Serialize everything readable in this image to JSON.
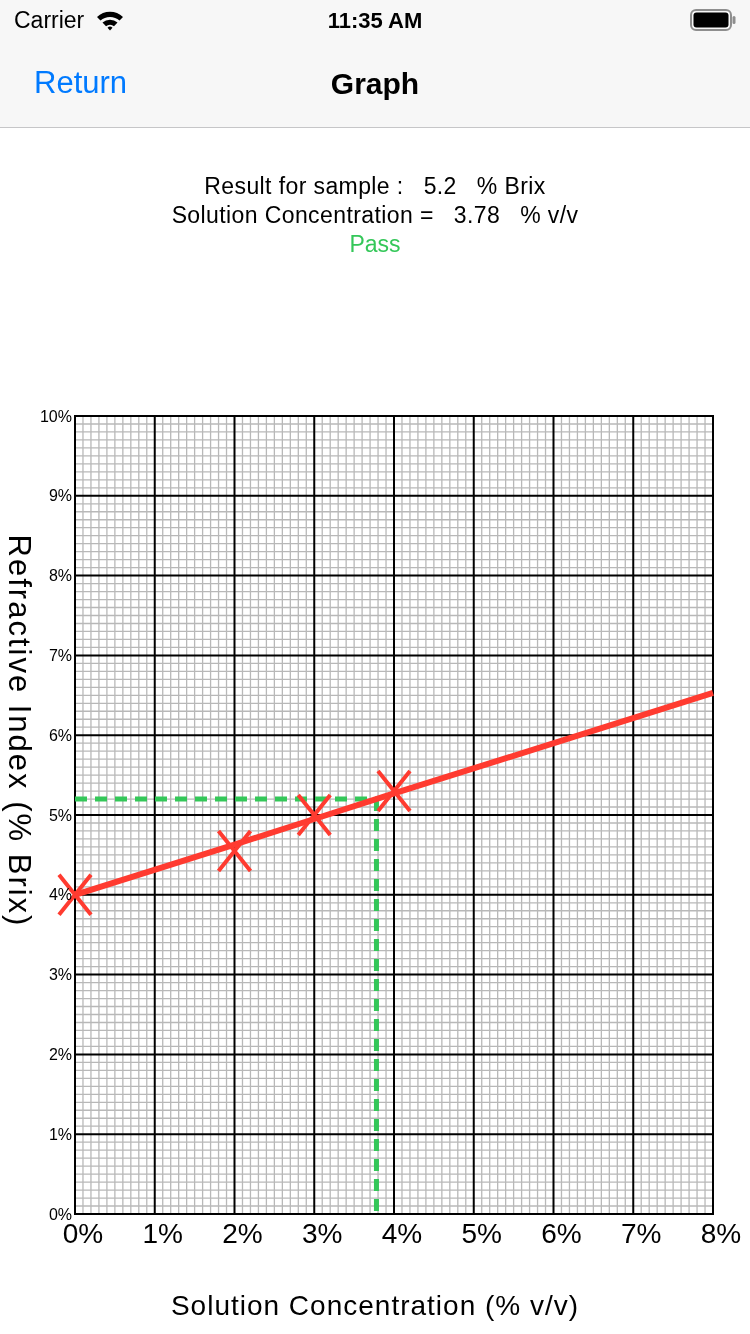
{
  "status_bar": {
    "carrier": "Carrier",
    "time": "11:35 AM"
  },
  "nav_bar": {
    "back_button": "Return",
    "title": "Graph"
  },
  "results": [
    {
      "label": "Result for sample :",
      "value": "5.2",
      "unit": "% Brix"
    },
    {
      "label": "Solution Concentration =",
      "value": "3.78",
      "unit": "% v/v"
    }
  ],
  "verdict": {
    "text": "Pass",
    "passed": true
  },
  "graph": {
    "chart_data": {
      "type": "scatter",
      "xlabel": "Solution Concentration (% v/v)",
      "ylabel": "Refractive Index (% Brix)",
      "x": [
        0,
        2,
        3,
        4,
        8
      ],
      "series": [
        {
          "color": "#ff3b30",
          "values": [
            4.0,
            4.55,
            5.0,
            5.3,
            null
          ]
        },
        {
          "type": "line",
          "color": "#ff3b30",
          "values": [
            4.0,
            4.63,
            4.95,
            5.27,
            6.53
          ]
        }
      ],
      "xlim": [
        0,
        8
      ],
      "ylim": [
        0,
        10
      ],
      "xticks": [
        {
          "value": 0,
          "label": "0%"
        },
        {
          "value": 1,
          "label": "1%"
        },
        {
          "value": 2,
          "label": "2%"
        },
        {
          "value": 3,
          "label": "3%"
        },
        {
          "value": 4,
          "label": "4%"
        },
        {
          "value": 5,
          "label": "5%"
        },
        {
          "value": 6,
          "label": "6%"
        },
        {
          "value": 7,
          "label": "7%"
        },
        {
          "value": 8,
          "label": "8%"
        }
      ],
      "yticks": [
        {
          "value": 0,
          "label": "0%"
        },
        {
          "value": 1,
          "label": "1%"
        },
        {
          "value": 2,
          "label": "2%"
        },
        {
          "value": 3,
          "label": "3%"
        },
        {
          "value": 4,
          "label": "4%"
        },
        {
          "value": 5,
          "label": "5%"
        },
        {
          "value": 6,
          "label": "6%"
        },
        {
          "value": 7,
          "label": "7%"
        },
        {
          "value": 8,
          "label": "8%"
        },
        {
          "value": 9,
          "label": "9%"
        },
        {
          "value": 10,
          "label": "10%"
        }
      ],
      "grid": true,
      "ref_lines": [
        {
          "axis": "y",
          "value": 5.2,
          "color": "#34c759"
        },
        {
          "axis": "x",
          "value": 3.78,
          "color": "#34c759"
        }
      ]
    }
  }
}
